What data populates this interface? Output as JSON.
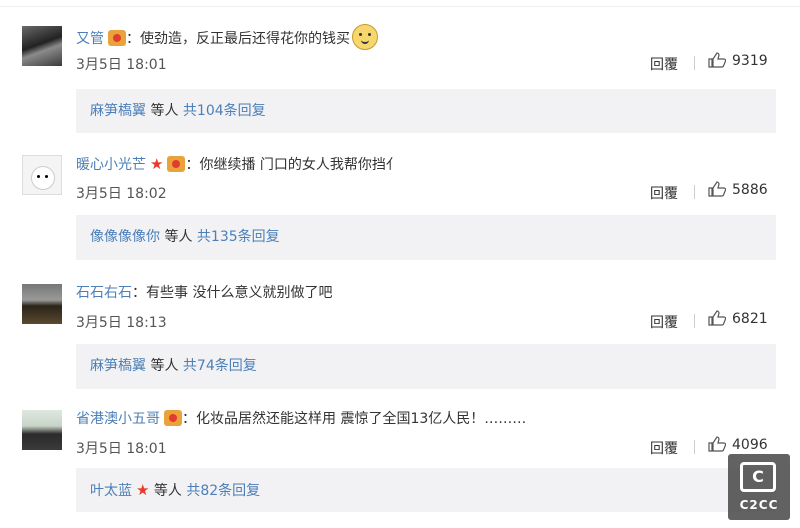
{
  "comments": [
    {
      "username": "又管",
      "text": "：使劲造，反正最后还得花你的钱买",
      "time": "3月5日 18:01",
      "reply_label": "回覆",
      "likes": "9319",
      "has_star": false,
      "has_emoji": true,
      "sub": {
        "names": "麻笋槗翼",
        "middle": " 等人 ",
        "count": "共104条回复"
      }
    },
    {
      "username": "暖心小光芒",
      "text": "：你继续播  门口的女人我帮你挡亻",
      "time": "3月5日 18:02",
      "reply_label": "回覆",
      "likes": "5886",
      "has_star": true,
      "has_emoji": false,
      "sub": {
        "names": "像像像像你",
        "middle": " 等人 ",
        "count": "共135条回复"
      }
    },
    {
      "username": "石石右石",
      "text": "：有些事 没什么意义就别做了吧",
      "time": "3月5日 18:13",
      "reply_label": "回覆",
      "likes": "6821",
      "has_star": false,
      "has_emoji": false,
      "sub": {
        "names": "麻笋槗翼",
        "middle": " 等人 ",
        "count": "共74条回复"
      }
    },
    {
      "username": "省港澳小五哥",
      "text": "：化妆品居然还能这样用 震惊了全国13亿人民！………",
      "time": "3月5日 18:01",
      "reply_label": "回覆",
      "likes": "4096",
      "has_star": false,
      "has_emoji": false,
      "sub": {
        "names": "叶太蓝",
        "middle": " 等人 ",
        "count": "共82条回复"
      }
    }
  ],
  "watermark": {
    "symbol": "C",
    "text": "C2CC"
  },
  "colors": {
    "link": "#4c7fb8",
    "star": "#e8392a",
    "subbox_bg": "#f2f2f5"
  }
}
